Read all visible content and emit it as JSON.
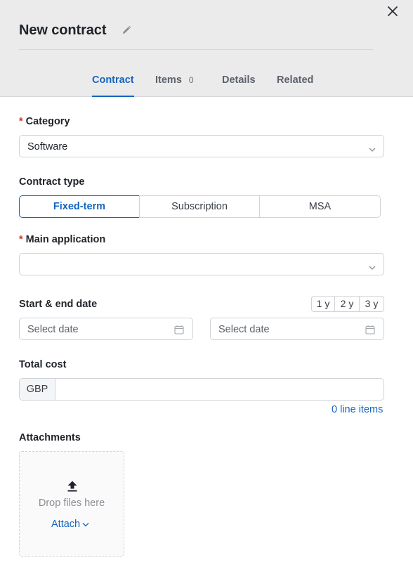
{
  "header": {
    "title": "New contract",
    "tabs": [
      {
        "label": "Contract",
        "active": true
      },
      {
        "label": "Items",
        "badge": "0"
      },
      {
        "label": "Details"
      },
      {
        "label": "Related"
      }
    ]
  },
  "form": {
    "required_marker": "*",
    "category": {
      "label": "Category",
      "value": "Software"
    },
    "contract_type": {
      "label": "Contract type",
      "options": [
        "Fixed-term",
        "Subscription",
        "MSA"
      ],
      "selected": "Fixed-term"
    },
    "main_application": {
      "label": "Main application",
      "value": ""
    },
    "dates": {
      "label": "Start & end date",
      "presets": [
        "1 y",
        "2 y",
        "3 y"
      ],
      "start_placeholder": "Select date",
      "end_placeholder": "Select date"
    },
    "total_cost": {
      "label": "Total cost",
      "currency": "GBP",
      "value": "",
      "line_items_link": "0 line items"
    },
    "attachments": {
      "label": "Attachments",
      "drop_text": "Drop files here",
      "attach_label": "Attach"
    }
  },
  "colors": {
    "accent": "#1565c0",
    "required": "#d6332b",
    "header_bg": "#ebebeb"
  },
  "icons": [
    "close-icon",
    "pencil-icon",
    "chevron-down-icon",
    "calendar-icon",
    "upload-icon"
  ]
}
